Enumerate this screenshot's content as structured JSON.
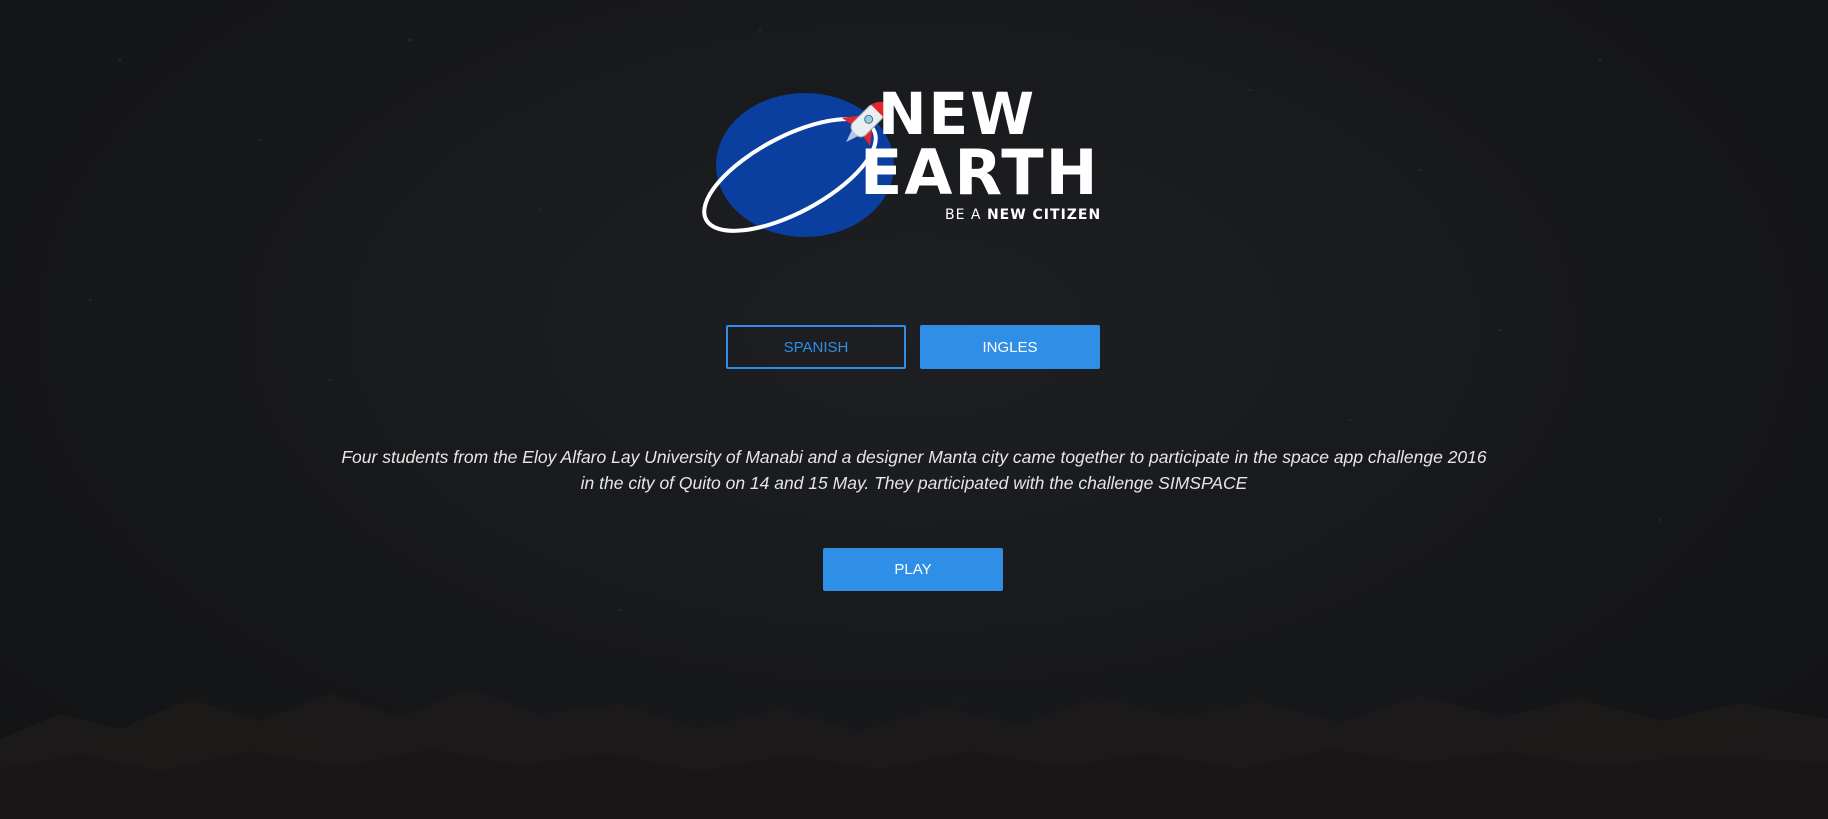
{
  "logo": {
    "title_line1": "NEW",
    "title_line2": "EARTH",
    "tagline_prefix": "BE A",
    "tagline_emphasis": "NEW CITIZEN"
  },
  "language": {
    "spanish_label": "SPANISH",
    "english_label": "INGLES",
    "selected": "INGLES"
  },
  "description": {
    "line1": "Four students from the Eloy Alfaro Lay University of Manabi and a designer Manta city came together to participate in the space app challenge 2016",
    "line2": "in the city of Quito on 14 and 15 May. They participated with the challenge SIMSPACE"
  },
  "play": {
    "label": "PLAY"
  },
  "colors": {
    "accent": "#2f8ee6",
    "background": "#161719",
    "planet": "#0a3fa0",
    "rocket_fins": "#e0262b"
  },
  "icons": {
    "planet": "planet-icon",
    "rocket": "rocket-icon",
    "orbit": "orbit-ring-icon"
  }
}
